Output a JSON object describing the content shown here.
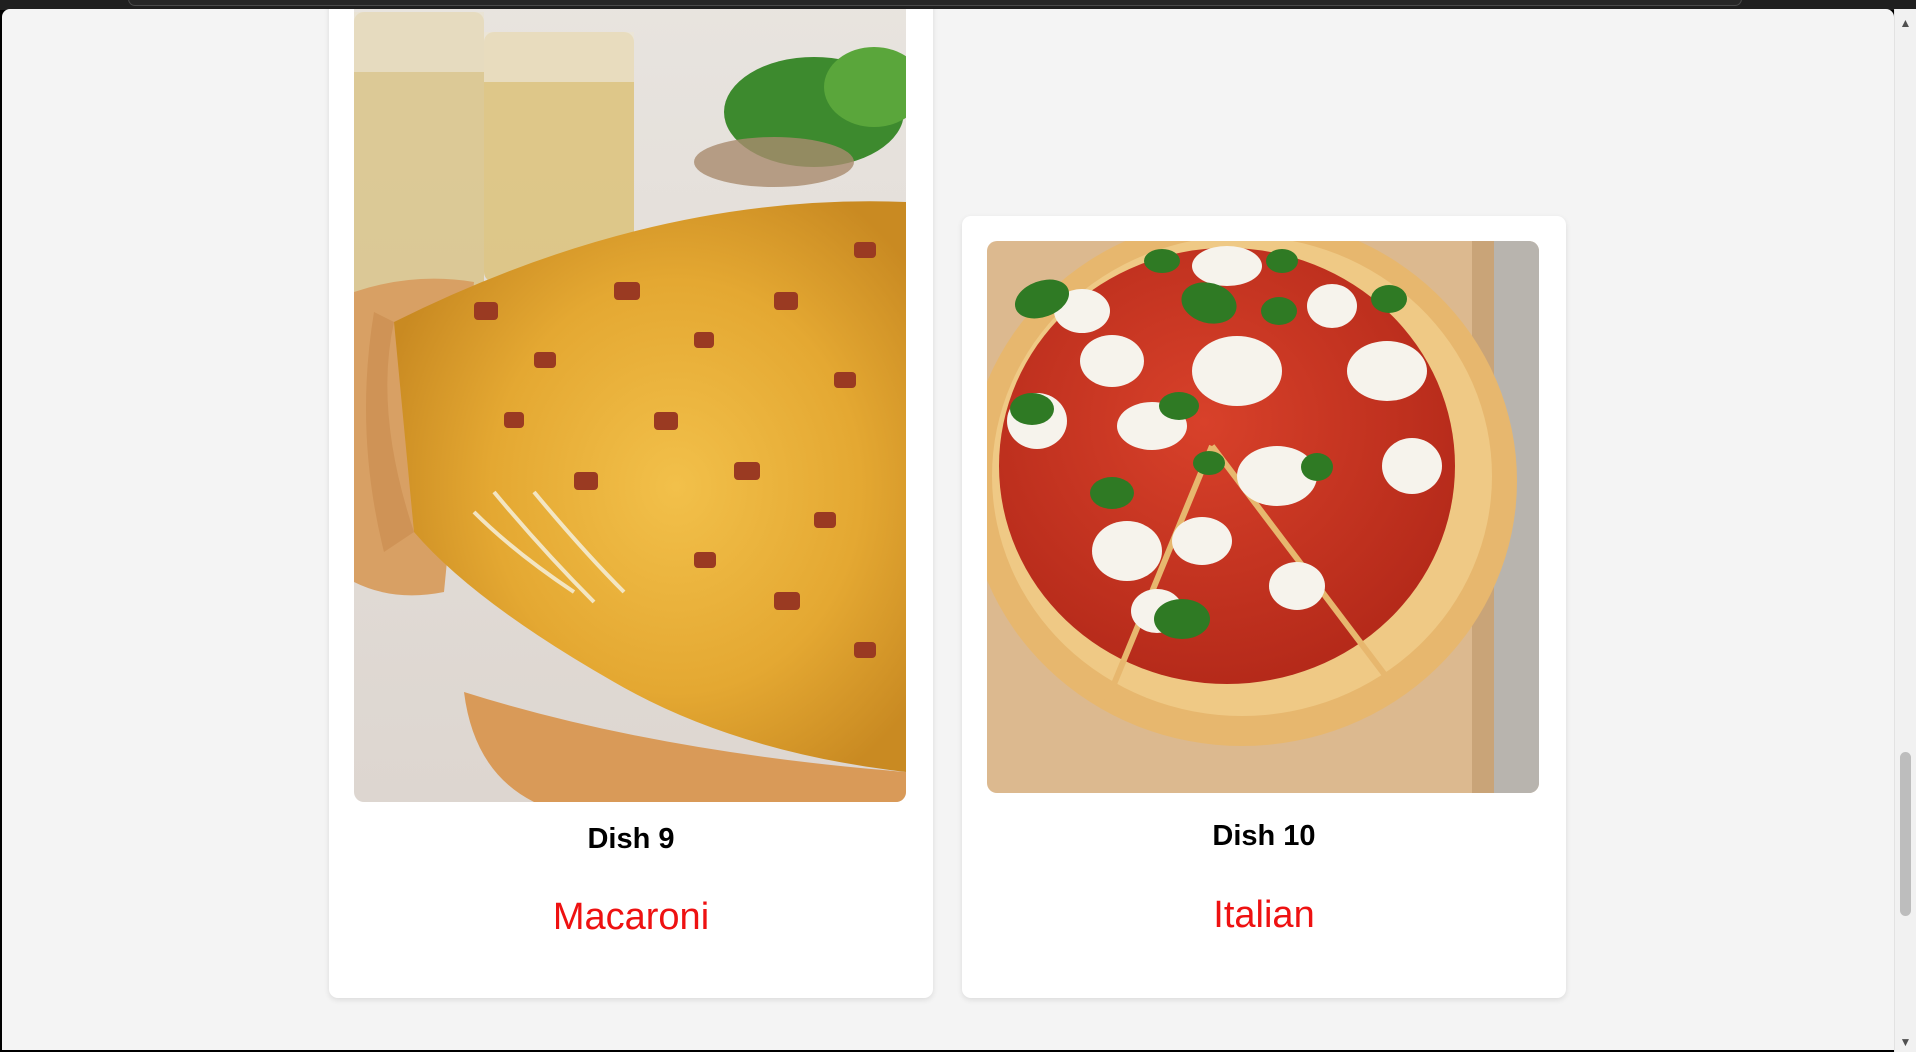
{
  "dishes": [
    {
      "title": "Dish 9",
      "name": "Macaroni"
    },
    {
      "title": "Dish 10",
      "name": "Italian"
    }
  ],
  "colors": {
    "page_bg": "#f4f4f4",
    "card_bg": "#ffffff",
    "dish_name": "#ee1111"
  },
  "icons": {
    "scroll_up": "triangle-up-icon",
    "scroll_down": "triangle-down-icon"
  }
}
